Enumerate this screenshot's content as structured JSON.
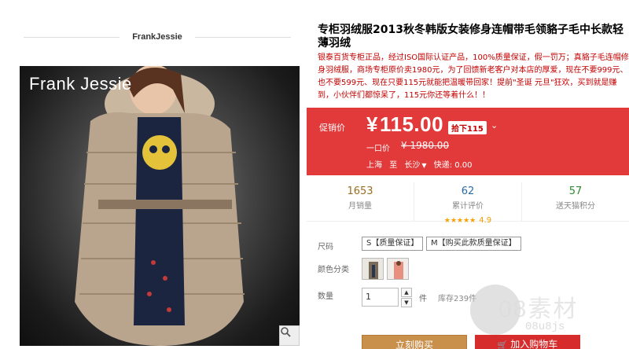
{
  "store": {
    "name": "FrankJessie"
  },
  "gallery": {
    "brand_overlay": "Frank Jessie"
  },
  "product": {
    "title": "专柜羽绒服2013秋冬韩版女装修身连帽带毛领貉子毛中长款轻薄羽绒",
    "description": "银泰百货专柜正品，经过ISO国际认证产品，100%质量保证，假一罚万；真貉子毛连帽修身羽绒服，商场专柜原价卖1980元，为了回馈新老客户对本店的厚爱，现在不要999元、也不要599元、现在只要115元就能把温暖带回家！提前\"圣诞 元旦\"狂欢，买到就是赚到，小伙伴们都惊呆了，115元你还等着什么！！"
  },
  "price": {
    "promo_label": "促销价",
    "currency": "¥",
    "current": "115.00",
    "discount_badge": "拾下115",
    "original_label": "一口价",
    "original": "¥ 1980.00"
  },
  "shipping": {
    "from": "上海",
    "to_word": "至",
    "dest": "长沙",
    "express": "快递: 0.00"
  },
  "stats": [
    {
      "value": "1653",
      "label": "月销量"
    },
    {
      "value": "62",
      "label": "累计评价",
      "stars": "★★★★★",
      "rating": "4.9"
    },
    {
      "value": "57",
      "label": "送天猫积分"
    }
  ],
  "options": {
    "size_label": "尺码",
    "sizes": [
      "S【质量保证】",
      "M【购买此款质量保证】"
    ],
    "color_label": "颜色分类",
    "qty_label": "数量",
    "qty_value": "1",
    "qty_unit": "件",
    "stock": "库存239件"
  },
  "actions": {
    "buy": "立刻购买",
    "cart": "加入购物车"
  },
  "watermark": {
    "main": "08素材",
    "sub": "08u8js"
  },
  "colors": {
    "price_bg": "#e23a3a",
    "buy_btn": "#c9904c",
    "cart_btn": "#d62c2c",
    "accent_red": "#c40000"
  }
}
